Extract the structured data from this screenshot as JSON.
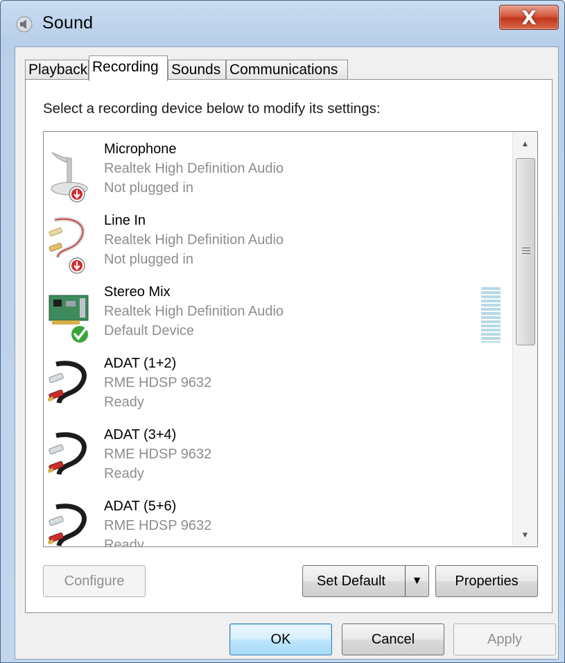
{
  "window": {
    "title": "Sound",
    "close_label": "X"
  },
  "tabs": [
    {
      "label": "Playback"
    },
    {
      "label": "Recording"
    },
    {
      "label": "Sounds"
    },
    {
      "label": "Communications"
    }
  ],
  "active_tab": "Recording",
  "instruction": "Select a recording device below to modify its settings:",
  "devices": [
    {
      "name": "Microphone",
      "driver": "Realtek High Definition Audio",
      "status": "Not plugged in",
      "icon": "microphone-icon",
      "badge": "unplugged-badge"
    },
    {
      "name": "Line In",
      "driver": "Realtek High Definition Audio",
      "status": "Not plugged in",
      "icon": "rca-cable-icon",
      "badge": "unplugged-badge"
    },
    {
      "name": "Stereo Mix",
      "driver": "Realtek High Definition Audio",
      "status": "Default Device",
      "icon": "sound-card-icon",
      "badge": "default-check-badge"
    },
    {
      "name": "ADAT (1+2)",
      "driver": "RME HDSP 9632",
      "status": "Ready",
      "icon": "rca-cable-icon"
    },
    {
      "name": "ADAT (3+4)",
      "driver": "RME HDSP 9632",
      "status": "Ready",
      "icon": "rca-cable-icon"
    },
    {
      "name": "ADAT (5+6)",
      "driver": "RME HDSP 9632",
      "status": "Ready",
      "icon": "rca-cable-icon"
    }
  ],
  "buttons": {
    "configure": "Configure",
    "set_default": "Set Default",
    "properties": "Properties",
    "ok": "OK",
    "cancel": "Cancel",
    "apply": "Apply"
  },
  "colors": {
    "accent": "#3c7fb1",
    "close": "#c0381c",
    "unplugged": "#d22a2a",
    "default_check": "#3aa53a",
    "level_meter": "#b6d9e6"
  }
}
